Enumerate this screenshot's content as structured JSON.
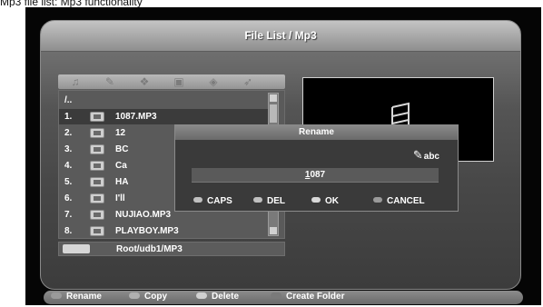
{
  "top_strip": {
    "text": "Mp3 file list: Mp3 functionality"
  },
  "window": {
    "title": "File List / Mp3"
  },
  "toolbar": {
    "icons": [
      "music-icon",
      "photo-icon",
      "video-icon",
      "folder-icon",
      "file-icon",
      "settings-icon"
    ]
  },
  "file_list": {
    "rows": [
      {
        "idx": "/..",
        "name": ""
      },
      {
        "idx": "1.",
        "name": "1087.MP3"
      },
      {
        "idx": "2.",
        "name": "12"
      },
      {
        "idx": "3.",
        "name": "BC"
      },
      {
        "idx": "4.",
        "name": "Ca"
      },
      {
        "idx": "5.",
        "name": "HA"
      },
      {
        "idx": "6.",
        "name": "I'll"
      },
      {
        "idx": "7.",
        "name": "NUJIAO.MP3"
      },
      {
        "idx": "8.",
        "name": "PLAYBOY.MP3"
      }
    ]
  },
  "path": {
    "text": "Root/udb1/MP3"
  },
  "dialog": {
    "title": "Rename",
    "mode": "abc",
    "value_first": "1",
    "value_rest": "087",
    "options": [
      {
        "label": "CAPS",
        "color": "#c0c0c0"
      },
      {
        "label": "DEL",
        "color": "#c0c0c0"
      },
      {
        "label": "OK",
        "color": "#d8d8d8"
      },
      {
        "label": "CANCEL",
        "color": "#9a9a9a"
      }
    ]
  },
  "bottom_bar": {
    "items": [
      {
        "label": "Rename",
        "color": "#9a9a9a"
      },
      {
        "label": "Copy",
        "color": "#b0b0b0"
      },
      {
        "label": "Delete",
        "color": "#d0d0d0"
      },
      {
        "label": "Create Folder",
        "color": "#7a7a7a"
      }
    ]
  }
}
